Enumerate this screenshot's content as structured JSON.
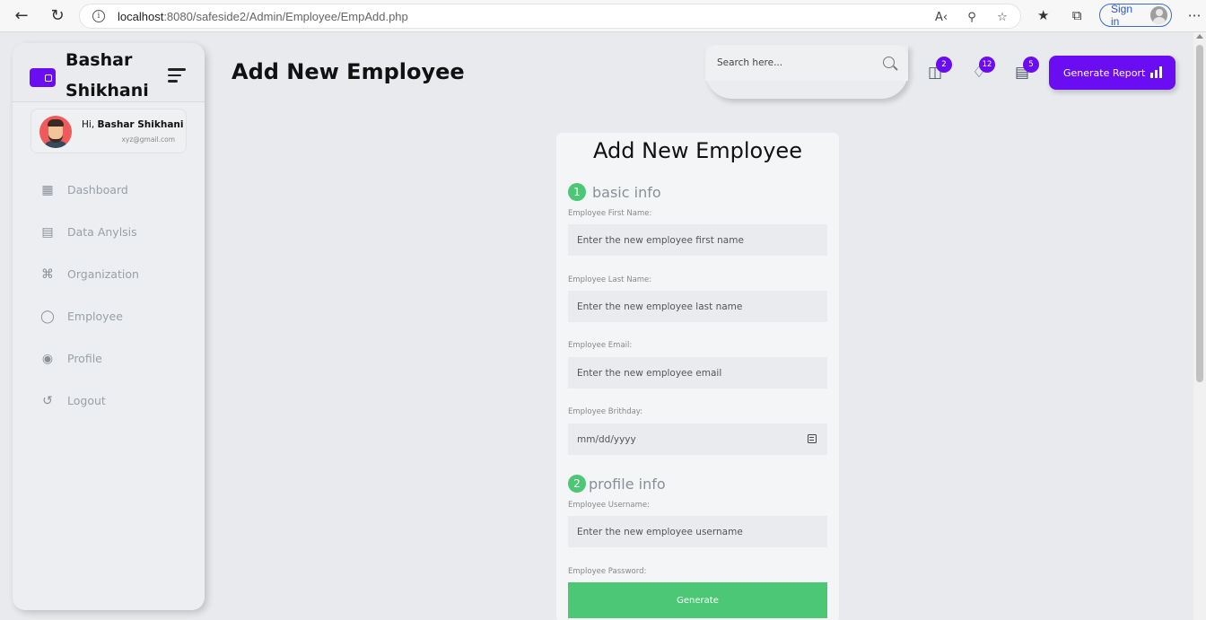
{
  "browser": {
    "url_host": "localhost",
    "url_path": ":8080/safeside2/Admin/Employee/EmpAdd.php",
    "sign_in_label": "Sign in"
  },
  "sidebar": {
    "brand_line1": "Bashar",
    "brand_line2": "Shikhani",
    "user": {
      "greeting_prefix": "Hi, ",
      "name": "Bashar Shikhani",
      "email": "xyz@gmail.com"
    },
    "items": [
      {
        "label": "Dashboard",
        "icon": "dashboard-icon"
      },
      {
        "label": "Data Anylsis",
        "icon": "activity-icon"
      },
      {
        "label": "Organization",
        "icon": "command-icon"
      },
      {
        "label": "Employee",
        "icon": "globe-icon"
      },
      {
        "label": "Profile",
        "icon": "world-icon"
      },
      {
        "label": "Logout",
        "icon": "history-icon"
      }
    ]
  },
  "header": {
    "title": "Add New Employee",
    "search_placeholder": "Search here...",
    "badges": {
      "gift": "2",
      "bell": "12",
      "chat": "5"
    },
    "report_button": "Generate Report"
  },
  "form": {
    "title": "Add New Employee",
    "section1": {
      "num": "1",
      "label": "basic info"
    },
    "first_name": {
      "label": "Employee First Name:",
      "placeholder": "Enter the new employee first name"
    },
    "last_name": {
      "label": "Employee Last Name:",
      "placeholder": "Enter the new employee last name"
    },
    "email": {
      "label": "Employee Email:",
      "placeholder": "Enter the new employee email"
    },
    "birthday": {
      "label": "Employee Brithday:",
      "placeholder": "mm/dd/yyyy"
    },
    "section2": {
      "num": "2",
      "label": "profile info"
    },
    "username": {
      "label": "Employee Username:",
      "placeholder": "Enter the new employee username"
    },
    "password": {
      "label": "Employee Password:"
    },
    "generate_button": "Generate"
  },
  "colors": {
    "accent": "#6a0df2",
    "success": "#4cc775",
    "background": "#e8eaed"
  }
}
